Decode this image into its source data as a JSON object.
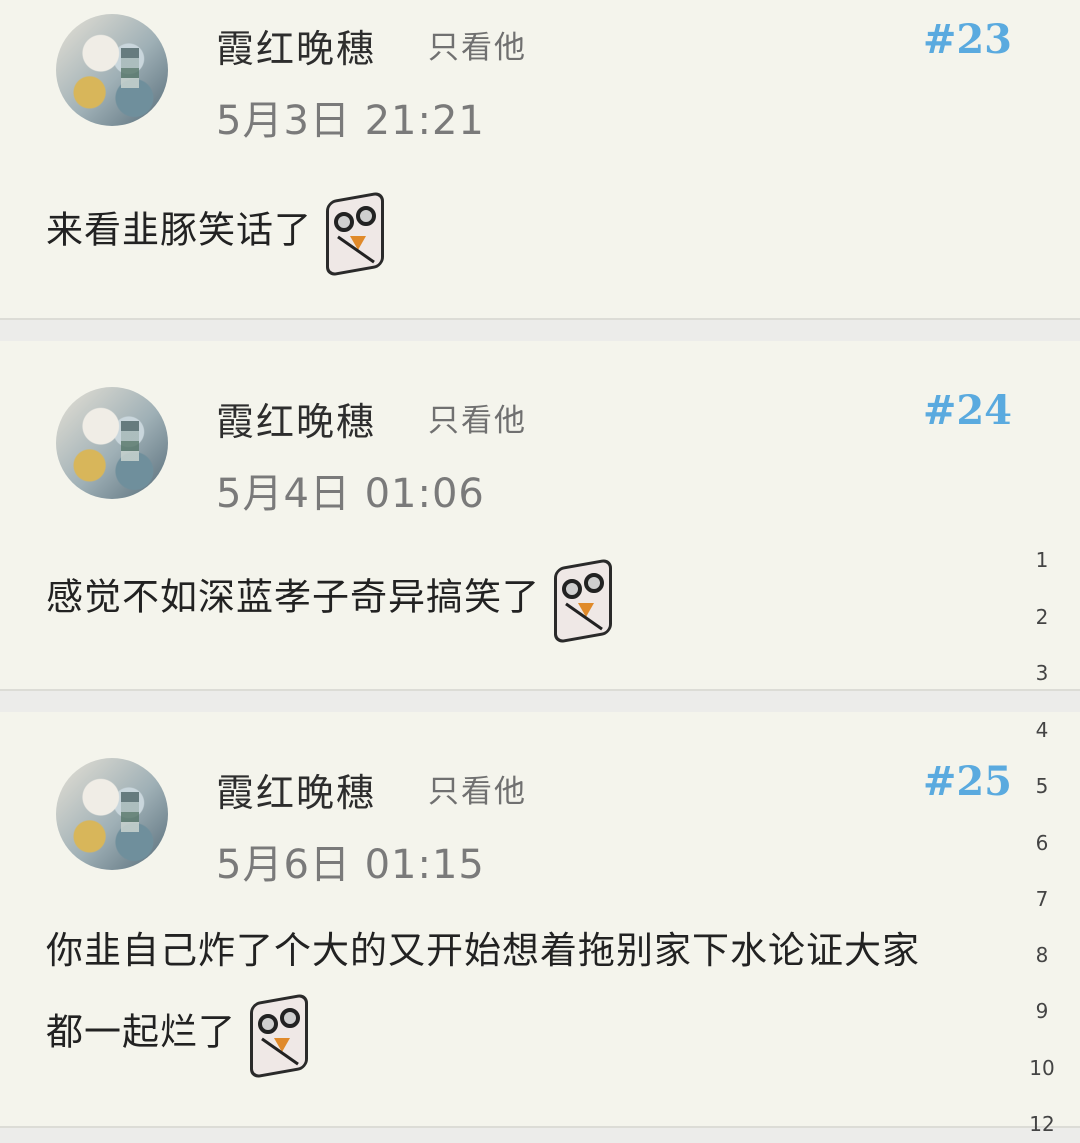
{
  "posts": [
    {
      "username": "霞红晚穗",
      "only_him": "只看他",
      "floor": "#23",
      "time": "5月3日 21:21",
      "content_lines": [
        "来看韭豚笑话了"
      ]
    },
    {
      "username": "霞红晚穗",
      "only_him": "只看他",
      "floor": "#24",
      "time": "5月4日 01:06",
      "content_lines": [
        "感觉不如深蓝孝子奇异搞笑了"
      ]
    },
    {
      "username": "霞红晚穗",
      "only_him": "只看他",
      "floor": "#25",
      "time": "5月6日 01:15",
      "content_lines": [
        "你韭自己炸了个大的又开始想着拖别家下水论证大家",
        "都一起烂了"
      ]
    }
  ],
  "line_numbers": [
    "1",
    "2",
    "3",
    "4",
    "5",
    "6",
    "7",
    "8",
    "9",
    "10",
    "12"
  ],
  "colors": {
    "floor": "#5aaadf",
    "card_bg": "#f4f4ec",
    "page_bg": "#ececea"
  }
}
